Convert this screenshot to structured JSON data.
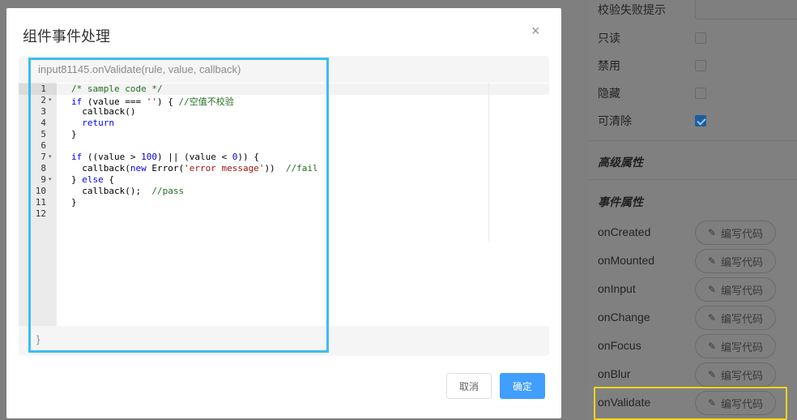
{
  "dialog": {
    "title": "组件事件处理",
    "close_icon": "×",
    "code_header": "input81145.onValidate(rule, value, callback)",
    "code_footer": "}",
    "lines": [
      {
        "n": "1",
        "fold": ""
      },
      {
        "n": "2",
        "fold": "▾"
      },
      {
        "n": "3",
        "fold": ""
      },
      {
        "n": "4",
        "fold": ""
      },
      {
        "n": "5",
        "fold": ""
      },
      {
        "n": "6",
        "fold": ""
      },
      {
        "n": "7",
        "fold": "▾"
      },
      {
        "n": "8",
        "fold": ""
      },
      {
        "n": "9",
        "fold": "▾"
      },
      {
        "n": "10",
        "fold": ""
      },
      {
        "n": "11",
        "fold": ""
      },
      {
        "n": "12",
        "fold": ""
      }
    ],
    "code": {
      "l1": "/* sample code */",
      "l2_kw": "if",
      "l2_a": " (value === ",
      "l2_str": "''",
      "l2_b": ") { ",
      "l2_comment": "//空值不校验",
      "l3": "  callback()",
      "l4_kw": "  return",
      "l5": "}",
      "l7_kw": "if",
      "l7_a": " ((value > ",
      "l7_num1": "100",
      "l7_b": ") || (value < ",
      "l7_num2": "0",
      "l7_c": ")) {",
      "l8_a": "  callback(",
      "l8_kw": "new",
      "l8_b": " Error(",
      "l8_str": "'error message'",
      "l8_c": "))  ",
      "l8_comment": "//fail",
      "l9_a": "} ",
      "l9_kw": "else",
      "l9_b": " {",
      "l10_a": "  callback();  ",
      "l10_comment": "//pass",
      "l11": "}"
    },
    "cancel_label": "取消",
    "ok_label": "确定"
  },
  "side_panel": {
    "validation_hint_label": "校验失败提示",
    "readonly_label": "只读",
    "disabled_label": "禁用",
    "hidden_label": "隐藏",
    "clearable_label": "可清除",
    "advanced_title": "高级属性",
    "events_title": "事件属性",
    "events": [
      {
        "name": "onCreated",
        "button": "编写代码"
      },
      {
        "name": "onMounted",
        "button": "编写代码"
      },
      {
        "name": "onInput",
        "button": "编写代码"
      },
      {
        "name": "onChange",
        "button": "编写代码"
      },
      {
        "name": "onFocus",
        "button": "编写代码"
      },
      {
        "name": "onBlur",
        "button": "编写代码"
      },
      {
        "name": "onValidate",
        "button": "编写代码"
      }
    ]
  },
  "icons": {
    "edit": "edit-pen-icon",
    "close": "close-icon",
    "check": "checkmark-icon"
  },
  "colors": {
    "primary": "#409eff",
    "highlight_blue": "#3bbdf0",
    "highlight_yellow": "#f7d51d"
  }
}
